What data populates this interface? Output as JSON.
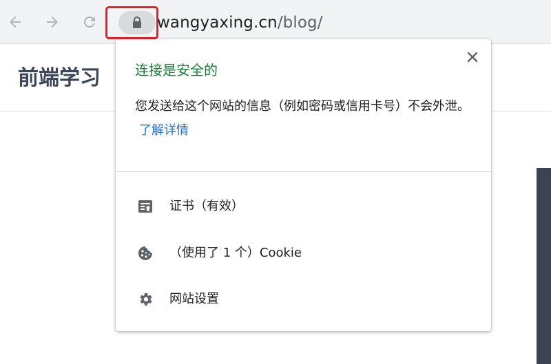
{
  "browser": {
    "url_host": "wangyaxing.cn",
    "url_path": "/blog/",
    "back_icon": "arrow-left-icon",
    "forward_icon": "arrow-right-icon",
    "reload_icon": "reload-icon",
    "lock_icon": "lock-icon",
    "highlight_color": "#e8202a"
  },
  "site": {
    "title": "前端学习"
  },
  "popup": {
    "title": "连接是安全的",
    "title_color": "#188038",
    "description": "您发送给这个网站的信息（例如密码或信用卡号）不会外泄。",
    "learn_more": "了解详情",
    "link_color": "#1a73e8",
    "close_icon": "close-icon",
    "items": [
      {
        "icon": "certificate-icon",
        "label": "证书（有效）"
      },
      {
        "icon": "cookie-icon",
        "label": "（使用了 1 个）Cookie"
      },
      {
        "icon": "gear-icon",
        "label": "网站设置"
      }
    ]
  }
}
